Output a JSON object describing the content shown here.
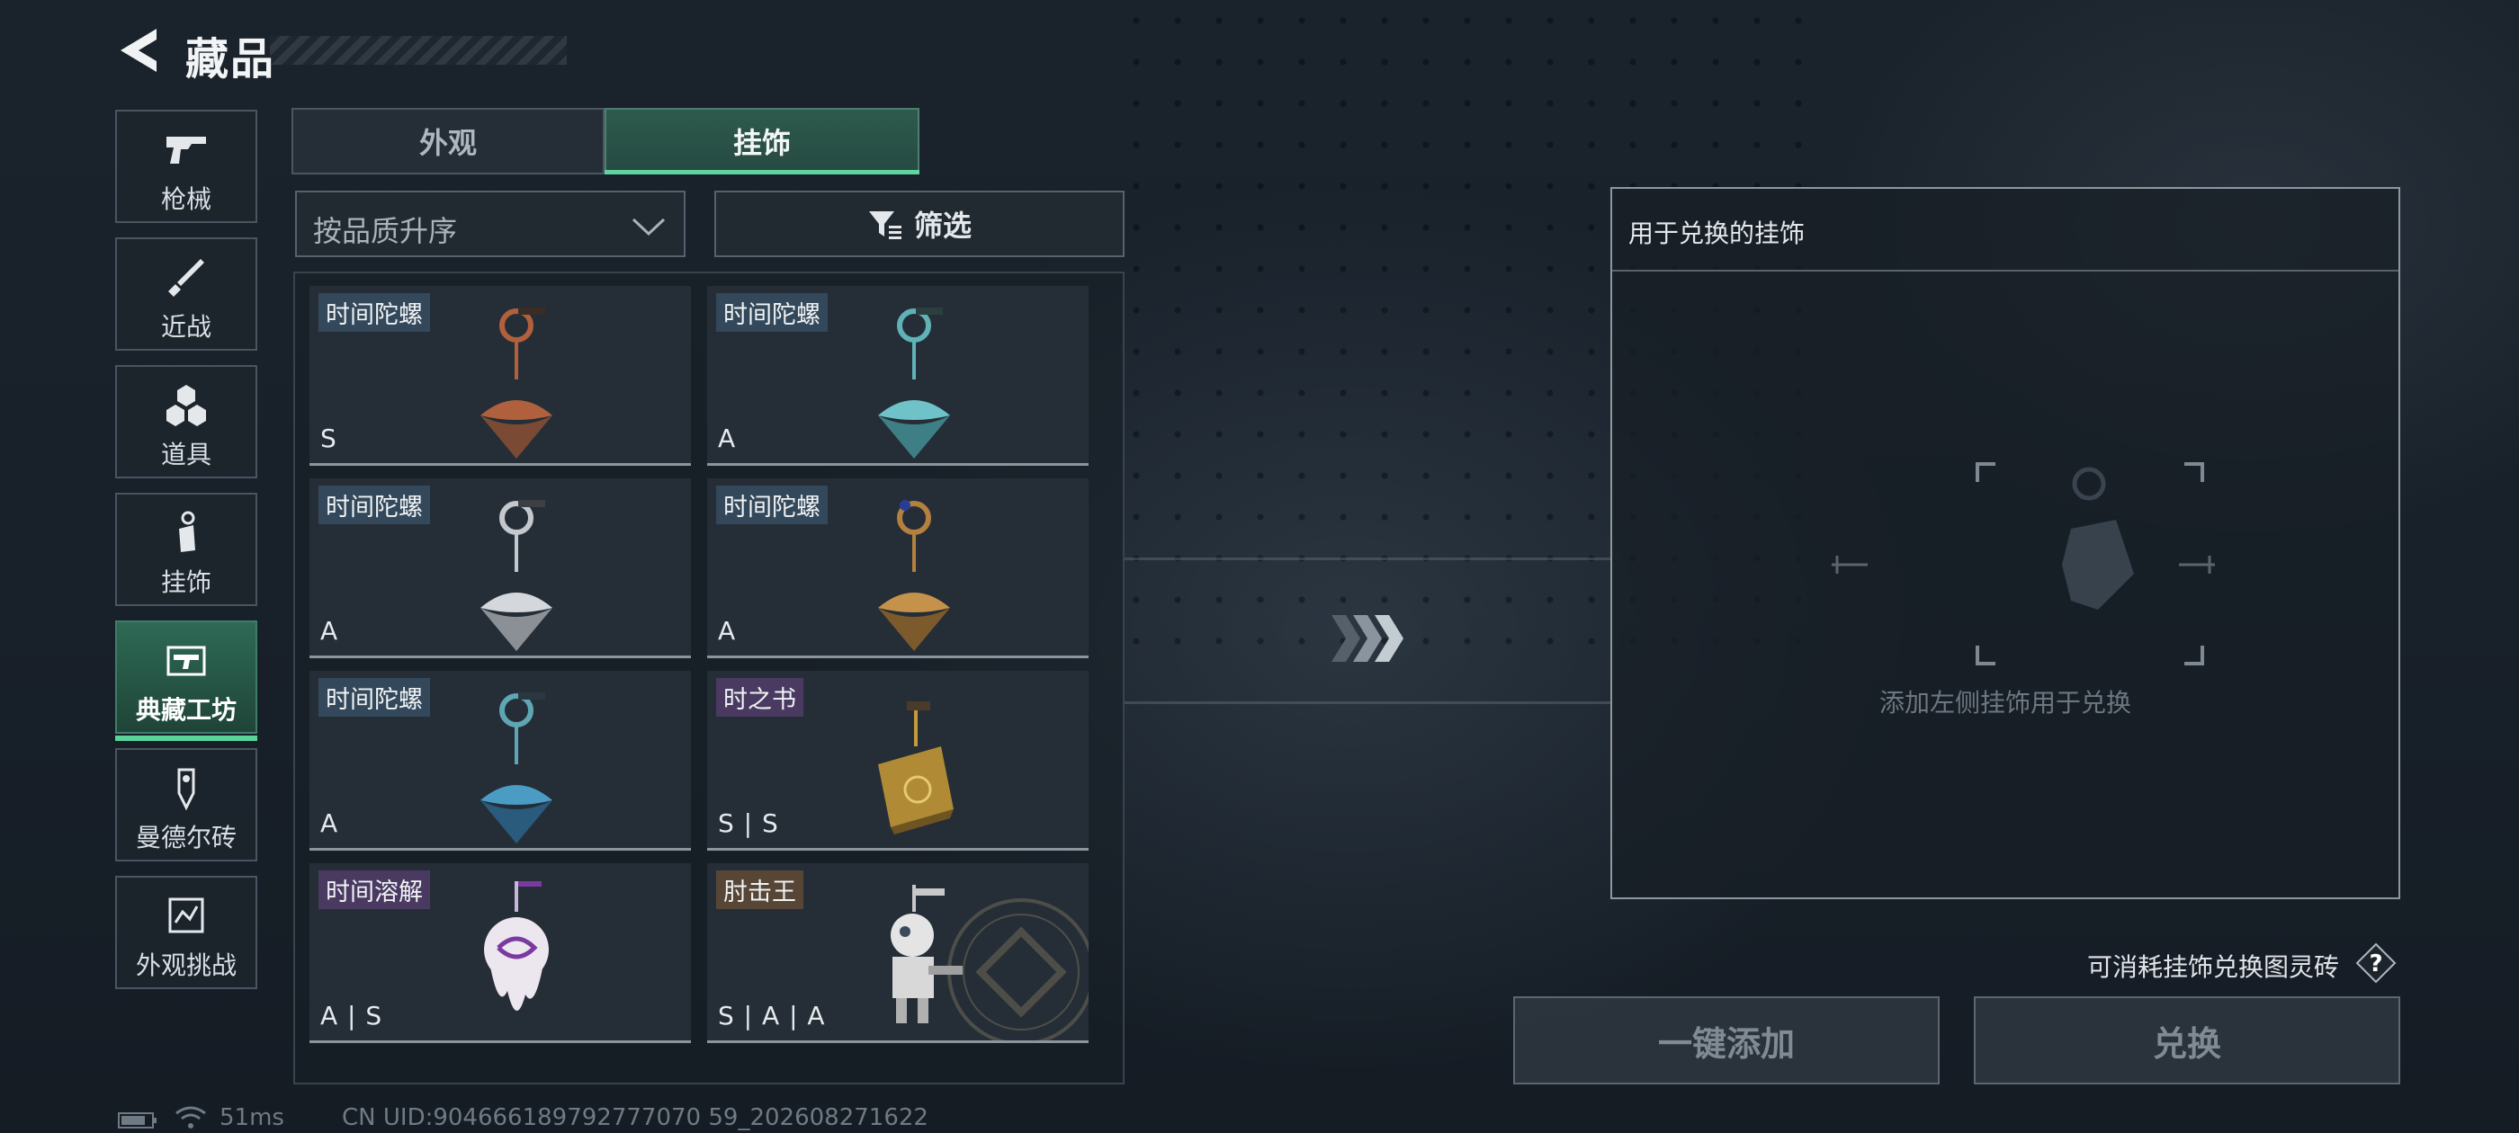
{
  "header": {
    "title": "藏品"
  },
  "sidebar": {
    "items": [
      {
        "label": "枪械",
        "icon": "gun-icon",
        "active": false
      },
      {
        "label": "近战",
        "icon": "knife-icon",
        "active": false
      },
      {
        "label": "道具",
        "icon": "cubes-icon",
        "active": false
      },
      {
        "label": "挂饰",
        "icon": "charm-icon",
        "active": false
      },
      {
        "label": "典藏工坊",
        "icon": "workshop-icon",
        "active": true
      },
      {
        "label": "曼德尔砖",
        "icon": "brick-icon",
        "active": false
      },
      {
        "label": "外观挑战",
        "icon": "challenge-icon",
        "active": false
      }
    ]
  },
  "tabs": [
    {
      "label": "外观",
      "active": false
    },
    {
      "label": "挂饰",
      "active": true
    }
  ],
  "sort": {
    "value": "按品质升序"
  },
  "filter": {
    "label": "筛选"
  },
  "cards": [
    {
      "name": "时间陀螺",
      "grade": "S",
      "color": "#b0603c",
      "tag_style": "blue"
    },
    {
      "name": "时间陀螺",
      "grade": "A",
      "color": "#5fb2b8",
      "tag_style": "blue"
    },
    {
      "name": "时间陀螺",
      "grade": "A",
      "color": "#c4c8cc",
      "tag_style": "blue"
    },
    {
      "name": "时间陀螺",
      "grade": "A",
      "color": "#b3803e",
      "tag_style": "blue"
    },
    {
      "name": "时间陀螺",
      "grade": "A",
      "color": "#3f8fb8",
      "tag_style": "blue"
    },
    {
      "name": "时之书",
      "grade": "S | S",
      "color": "#c49a3a",
      "tag_style": "purple"
    },
    {
      "name": "时间溶解",
      "grade": "A | S",
      "color": "#e6e0e8",
      "tag_style": "purple"
    },
    {
      "name": "肘击王",
      "grade": "S | A | A",
      "color": "#d8d8d8",
      "tag_style": "brown"
    }
  ],
  "exchange": {
    "title": "用于兑换的挂饰",
    "empty_hint": "添加左侧挂饰用于兑换",
    "note": "可消耗挂饰兑换图灵砖"
  },
  "buttons": {
    "add_all": "一键添加",
    "exchange": "兑换"
  },
  "status": {
    "ping": "51ms",
    "uid": "CN UID:904666189792777070 59_202608271622"
  },
  "colors": {
    "accent": "#5fd3a0"
  }
}
